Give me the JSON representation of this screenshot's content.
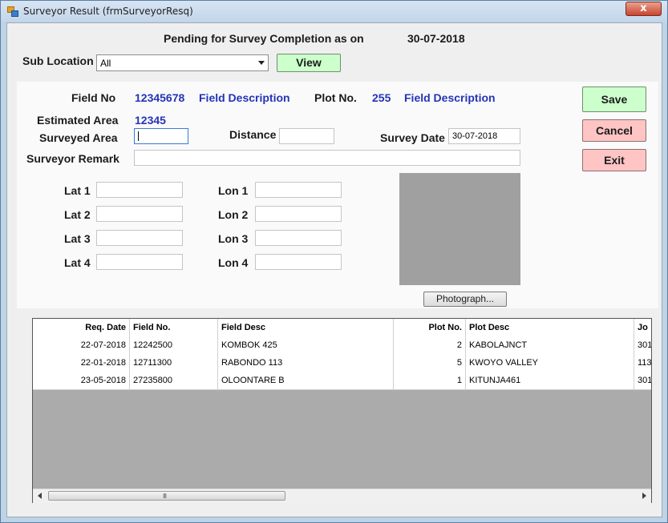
{
  "window": {
    "title": "Surveyor Result (frmSurveyorResq)",
    "close_glyph": "x"
  },
  "header": {
    "heading": "Pending for Survey Completion  as on",
    "date": "30-07-2018"
  },
  "filter": {
    "sub_location_label": "Sub Location",
    "sub_location_value": "All",
    "view_label": "View"
  },
  "details": {
    "field_no_label": "Field No",
    "field_no_value": "12345678",
    "field_desc_1": "Field Description",
    "plot_no_label": "Plot No.",
    "plot_no_value": "255",
    "field_desc_2": "Field Description",
    "estimated_area_label": "Estimated Area",
    "estimated_area_value": "12345",
    "surveyed_area_label": "Surveyed Area",
    "surveyed_area_value": "",
    "distance_label": "Distance",
    "distance_value": "",
    "survey_date_label": "Survey Date",
    "survey_date_value": "30-07-2018",
    "surveyor_remark_label": "Surveyor Remark",
    "surveyor_remark_value": ""
  },
  "coords": {
    "lat1_label": "Lat 1",
    "lat2_label": "Lat 2",
    "lat3_label": "Lat 3",
    "lat4_label": "Lat 4",
    "lon1_label": "Lon 1",
    "lon2_label": "Lon 2",
    "lon3_label": "Lon 3",
    "lon4_label": "Lon 4"
  },
  "actions": {
    "save": "Save",
    "cancel": "Cancel",
    "exit": "Exit",
    "photograph": "Photograph..."
  },
  "table": {
    "columns": [
      "Req. Date",
      "Field No.",
      "Field Desc",
      "Plot No.",
      "Plot Desc",
      "Jo"
    ],
    "rows": [
      [
        "22-07-2018",
        "12242500",
        "KOMBOK 425",
        "2",
        "KABOLAJNCT",
        "301"
      ],
      [
        "22-01-2018",
        "12711300",
        "RABONDO 113",
        "5",
        "KWOYO VALLEY",
        "113"
      ],
      [
        "23-05-2018",
        "27235800",
        "OLOONTARE B",
        "1",
        "KITUNJA461",
        "301"
      ]
    ],
    "scroll_grip": "III"
  },
  "colors": {
    "save_bg": "#ccffcc",
    "cancel_bg": "#ffc4c4",
    "label_blue": "#2434b8",
    "photo_bg": "#a0a0a0"
  }
}
